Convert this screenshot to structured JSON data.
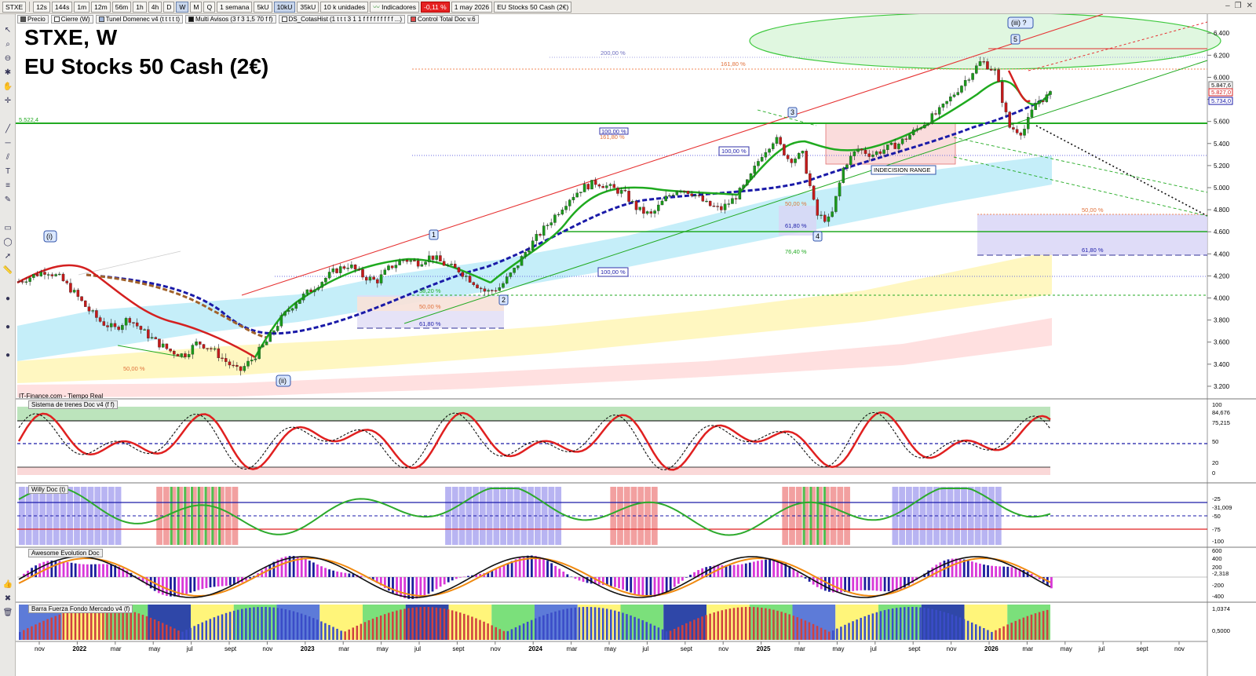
{
  "toolbar": {
    "symbol": "STXE",
    "intervals": [
      "12s",
      "144s",
      "1m",
      "12m",
      "56m",
      "1h",
      "4h",
      "D",
      "W",
      "M",
      "Q"
    ],
    "active_interval": "W",
    "period": "1 semana",
    "ticks": [
      "5kU",
      "10kU",
      "35kU"
    ],
    "active_tick": "10kU",
    "units": "10 k unidades",
    "indicators_label": "Indicadores",
    "change": "-0,11 %",
    "date": "1 may 2026",
    "instrument": "EU Stocks 50 Cash (2€)"
  },
  "legend": [
    "Precio",
    "Cierre (W)",
    "Tunel Domenec v4 (t t t t t)",
    "Multi Avisos (3 f 3 1,5 70 f f)",
    "DS_CotasHist (1 t t t 3 1 1 f f f f f f f f f ...)",
    "Control Total Doc v.6"
  ],
  "chart_title": {
    "line1": "STXE, W",
    "line2": "EU Stocks 50 Cash (2€)"
  },
  "source": "IT-Finance.com - Tiempo Real",
  "panels": {
    "trenes": "Sistema de trenes Doc v4 (f f)",
    "willy": "Willy Doc (t)",
    "awesome": "Awesome Evolution Doc",
    "barra": "Barra Fuerza Fondo Mercado v4 (f)"
  },
  "chart_data": {
    "type": "candlestick",
    "x_labels": [
      "nov",
      "2022",
      "mar",
      "may",
      "jul",
      "sept",
      "nov",
      "2023",
      "mar",
      "may",
      "jul",
      "sept",
      "nov",
      "2024",
      "mar",
      "may",
      "jul",
      "sept",
      "nov",
      "2025",
      "mar",
      "may",
      "jul",
      "sept",
      "nov",
      "2026",
      "mar",
      "may",
      "jul",
      "sept",
      "nov"
    ],
    "price_axis": [
      "6.400",
      "6.200",
      "6.000",
      "5.800",
      "5.600",
      "5.400",
      "5.200",
      "5.000",
      "4.800",
      "4.600",
      "4.400",
      "4.200",
      "4.000",
      "3.800",
      "3.600",
      "3.400",
      "3.200"
    ],
    "price_range": [
      3100,
      6480
    ],
    "last_price_labels": [
      "5.847,6",
      "5.827,0",
      "5.734,0"
    ],
    "level_label": "5.522,4",
    "wave_labels": [
      "(i)",
      "(ii)",
      "1",
      "2",
      "3",
      "4",
      "5",
      "(iii) ?"
    ],
    "fib_labels": [
      "200,00 %",
      "161,80 %",
      "100,00 %",
      "161,80 %",
      "100,00 %",
      "100,00 %",
      "61,80 %",
      "50,00 %",
      "76,40 %",
      "38,20 %",
      "50,00 %",
      "61,80 %",
      "50,00 %",
      "50,00 %",
      "61,80 %"
    ],
    "range_label": "INDECISION RANGE",
    "closes": [
      4150,
      4200,
      4250,
      4180,
      4050,
      3900,
      3780,
      3720,
      3820,
      3700,
      3600,
      3520,
      3480,
      3600,
      3540,
      3430,
      3330,
      3450,
      3600,
      3800,
      3950,
      4050,
      4150,
      4250,
      4300,
      4200,
      4150,
      4280,
      4350,
      4320,
      4380,
      4300,
      4250,
      4150,
      4050,
      4100,
      4250,
      4450,
      4600,
      4750,
      4900,
      5000,
      5050,
      5000,
      4950,
      4800,
      4750,
      4900,
      5000,
      4950,
      4850,
      4800,
      4900,
      5050,
      5300,
      5450,
      5250,
      5300,
      4750,
      4700,
      5200,
      5350,
      5300,
      5350,
      5400,
      5500,
      5600,
      5700,
      5850,
      6000,
      6150,
      6050,
      5550,
      5500,
      5780,
      5840
    ],
    "trenes_axis": [
      "100",
      "84,676",
      "75,215",
      "50",
      "20",
      "0"
    ],
    "willy_axis": [
      "-25",
      "-31,009",
      "-50",
      "-75",
      "-100"
    ],
    "awesome_axis": [
      "600",
      "400",
      "200",
      "-2,318",
      "-200",
      "-400"
    ],
    "barra_axis": [
      "1,0374",
      "0,5000"
    ]
  }
}
